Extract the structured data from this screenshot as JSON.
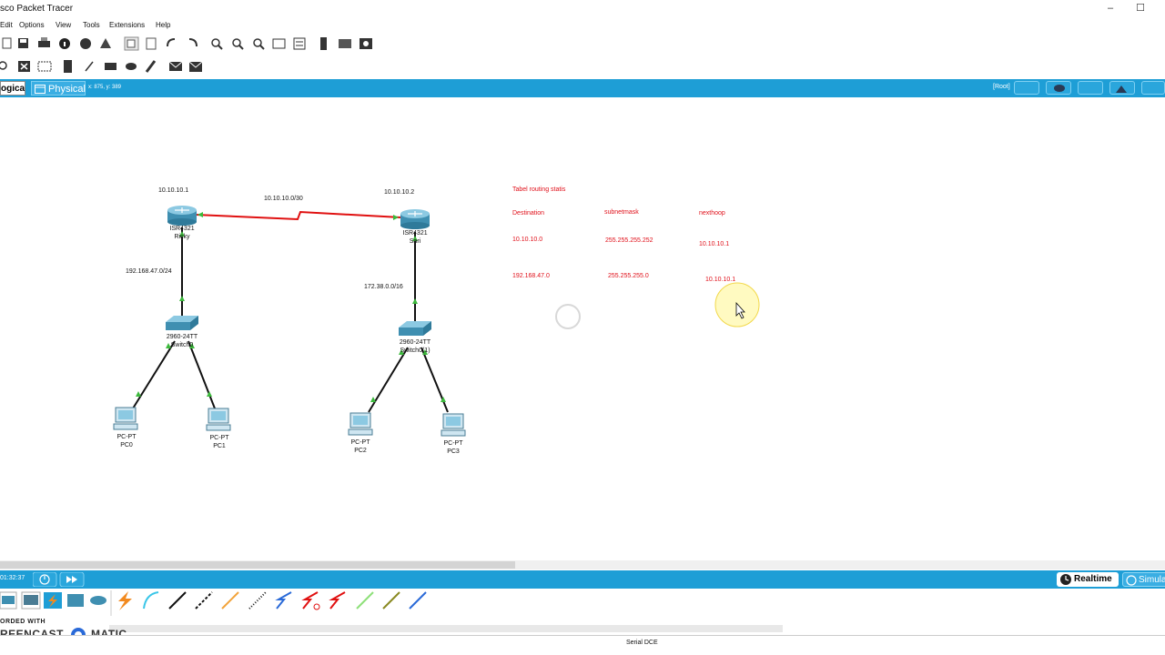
{
  "window": {
    "title": "sco Packet Tracer"
  },
  "menu": [
    "Edit",
    "Options",
    "View",
    "Tools",
    "Extensions",
    "Help"
  ],
  "workspace": {
    "tab_logical": "ogical",
    "tab_physical": "Physical",
    "coords": "x: 875, y: 389",
    "root_label": "[Root]"
  },
  "topology": {
    "links": {
      "serial_net": "10.10.10.0/30",
      "left_lan": "192.168.47.0/24",
      "right_lan": "172.38.0.0/16"
    },
    "routers": [
      {
        "ip": "10.10.10.1",
        "model": "ISR4321",
        "name": "Ricky"
      },
      {
        "ip": "10.10.10.2",
        "model": "ISR4321",
        "name": "Sari"
      }
    ],
    "switches": [
      {
        "model": "2960-24TT",
        "name": "Switch0"
      },
      {
        "model": "2960-24TT",
        "name": "Switch0(1)"
      }
    ],
    "pcs": [
      {
        "model": "PC-PT",
        "name": "PC0"
      },
      {
        "model": "PC-PT",
        "name": "PC1"
      },
      {
        "model": "PC-PT",
        "name": "PC2"
      },
      {
        "model": "PC-PT",
        "name": "PC3"
      }
    ]
  },
  "routing_table": {
    "title": "Tabel routing statis",
    "headers": [
      "Destination",
      "subnetmask",
      "nexthoop"
    ],
    "rows": [
      [
        "10.10.10.0",
        "255.255.255.252",
        "10.10.10.1"
      ],
      [
        "192.168.47.0",
        "255.255.255.0",
        "10.10.10.1"
      ]
    ]
  },
  "bottom": {
    "timer": "01:32:37",
    "realtime": "Realtime",
    "simulation": "Simula",
    "status": "Serial DCE"
  },
  "watermark": {
    "line1": "ORDED WITH",
    "line2": "REENCAST",
    "line3": "MATIC"
  },
  "colors": {
    "accent": "#1e9ed6",
    "serial_link": "#e01010",
    "link_up": "#3cb93c",
    "annotation": "#e0101a"
  }
}
